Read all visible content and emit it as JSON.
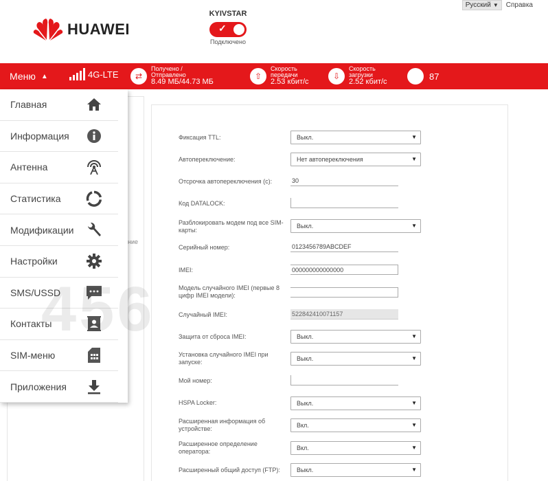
{
  "header": {
    "language": "Русский",
    "help": "Справка",
    "logo_text": "HUAWEI",
    "operator": "KYIVSTAR",
    "status": "Подключено"
  },
  "statusbar": {
    "menu_label": "Меню",
    "network": "4G-LTE",
    "traffic_label": "Получено / Отправлено",
    "traffic_value": "8.49 МБ/44.73 МБ",
    "upload_label": "Скорость передачи",
    "upload_value": "2.53 кбит/с",
    "download_label": "Скорость загрузки",
    "download_value": "2.52 кбит/с",
    "temperature": "87",
    "colors": {
      "accent": "#e4181b"
    }
  },
  "menu": {
    "items": [
      {
        "label": "Главная",
        "icon": "home-icon"
      },
      {
        "label": "Информация",
        "icon": "info-icon"
      },
      {
        "label": "Антенна",
        "icon": "antenna-icon"
      },
      {
        "label": "Статистика",
        "icon": "pie-chart-icon"
      },
      {
        "label": "Модификации",
        "icon": "wrench-icon"
      },
      {
        "label": "Настройки",
        "icon": "gear-icon"
      },
      {
        "label": "SMS/USSD",
        "icon": "message-icon"
      },
      {
        "label": "Контакты",
        "icon": "contacts-icon"
      },
      {
        "label": "SIM-меню",
        "icon": "sim-card-icon"
      },
      {
        "label": "Приложения",
        "icon": "download-icon"
      }
    ]
  },
  "background": {
    "partial_text": "ние",
    "watermark": "456"
  },
  "form": {
    "ttl_label": "Фиксация TTL:",
    "ttl_value": "Выкл.",
    "autoswitch_label": "Автопереключение:",
    "autoswitch_value": "Нет автопереключения",
    "delay_label": "Отсрочка автопереключения (с):",
    "delay_value": "30",
    "datalock_label": "Код DATALOCK:",
    "datalock_value": "",
    "unlock_label": "Разблокировать модем под все SIM-карты:",
    "unlock_value": "Выкл.",
    "serial_label": "Серийный номер:",
    "serial_value": "0123456789ABCDEF",
    "imei_label": "IMEI:",
    "imei_value": "000000000000000",
    "random_model_label": "Модель случайного IMEI (первые 8 цифр IMEI модели):",
    "random_model_value": "",
    "random_imei_label": "Случайный IMEI:",
    "random_imei_value": "522842410071157",
    "imei_protect_label": "Защита от сброса IMEI:",
    "imei_protect_value": "Выкл.",
    "random_on_start_label": "Установка случайного IMEI при запуске:",
    "random_on_start_value": "Выкл.",
    "my_number_label": "Мой номер:",
    "my_number_value": "",
    "hspa_label": "HSPA Locker:",
    "hspa_value": "Выкл.",
    "ext_info_label": "Расширенная информация об устройстве:",
    "ext_info_value": "Вкл.",
    "ext_operator_label": "Расширенное определение оператора:",
    "ext_operator_value": "Вкл.",
    "ftp_label": "Расширенный общий доступ (FTP):",
    "ftp_value": "Выкл."
  }
}
